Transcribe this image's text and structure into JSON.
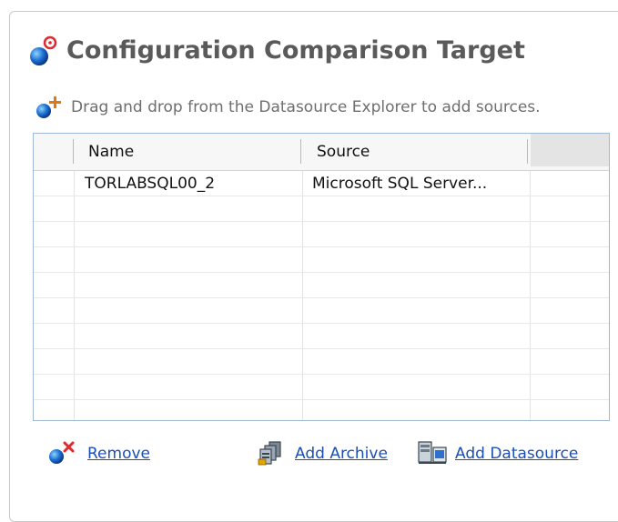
{
  "panel": {
    "title": "Configuration Comparison Target",
    "hint": "Drag and drop from the Datasource Explorer to add sources."
  },
  "grid": {
    "columns": [
      "Name",
      "Source"
    ],
    "rows": [
      {
        "name": "TORLABSQL00_2",
        "source": "Microsoft SQL Server..."
      }
    ]
  },
  "actions": {
    "remove": "Remove",
    "add_archive": "Add Archive",
    "add_datasource": "Add Datasource"
  },
  "icons": {
    "title": "target-icon",
    "hint": "add-source-icon",
    "remove": "remove-icon",
    "add_archive": "archive-icon",
    "add_datasource": "datasource-icon"
  },
  "colors": {
    "link": "#1a4fb5",
    "title": "#5a5a5a",
    "accent_red": "#e0282e"
  }
}
